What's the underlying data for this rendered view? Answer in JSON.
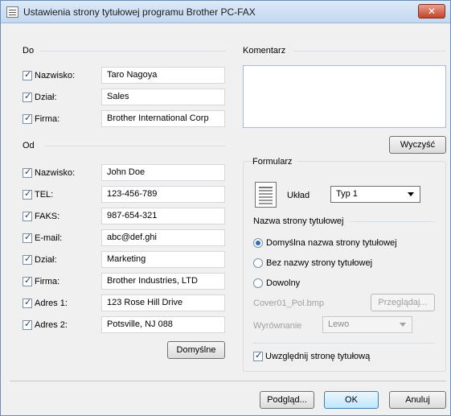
{
  "window": {
    "title": "Ustawienia strony tytułowej programu Brother PC-FAX",
    "close_label": "✕"
  },
  "to_group": {
    "title": "Do",
    "fields": [
      {
        "label": "Nazwisko:",
        "checked": true,
        "value": "Taro Nagoya"
      },
      {
        "label": "Dział:",
        "checked": true,
        "value": "Sales"
      },
      {
        "label": "Firma:",
        "checked": true,
        "value": "Brother International Corp"
      }
    ]
  },
  "from_group": {
    "title": "Od",
    "fields": [
      {
        "label": "Nazwisko:",
        "checked": true,
        "value": "John Doe"
      },
      {
        "label": "TEL:",
        "checked": true,
        "value": "123-456-789"
      },
      {
        "label": "FAKS:",
        "checked": true,
        "value": "987-654-321"
      },
      {
        "label": "E-mail:",
        "checked": true,
        "value": "abc@def.ghi"
      },
      {
        "label": "Dział:",
        "checked": true,
        "value": "Marketing"
      },
      {
        "label": "Firma:",
        "checked": true,
        "value": "Brother Industries, LTD"
      },
      {
        "label": "Adres 1:",
        "checked": true,
        "value": "123 Rose Hill Drive"
      },
      {
        "label": "Adres 2:",
        "checked": true,
        "value": "Potsville, NJ 088"
      }
    ],
    "default_button": "Domyślne"
  },
  "comment": {
    "title": "Komentarz",
    "value": "",
    "clear_button": "Wyczyść"
  },
  "form": {
    "title": "Formularz",
    "layout_label": "Układ",
    "layout_value": "Typ 1",
    "cover_name_title": "Nazwa strony tytułowej",
    "radio_default": "Domyślna nazwa strony tytułowej",
    "radio_none": "Bez nazwy strony tytułowej",
    "radio_custom": "Dowolny",
    "file_name": "Cover01_Pol.bmp",
    "browse_button": "Przeglądaj...",
    "align_label": "Wyrównanie",
    "align_value": "Lewo",
    "include_label": "Uwzględnij stronę tytułową",
    "include_checked": true
  },
  "footer": {
    "preview_button": "Podgląd...",
    "ok_button": "OK",
    "cancel_button": "Anuluj"
  }
}
